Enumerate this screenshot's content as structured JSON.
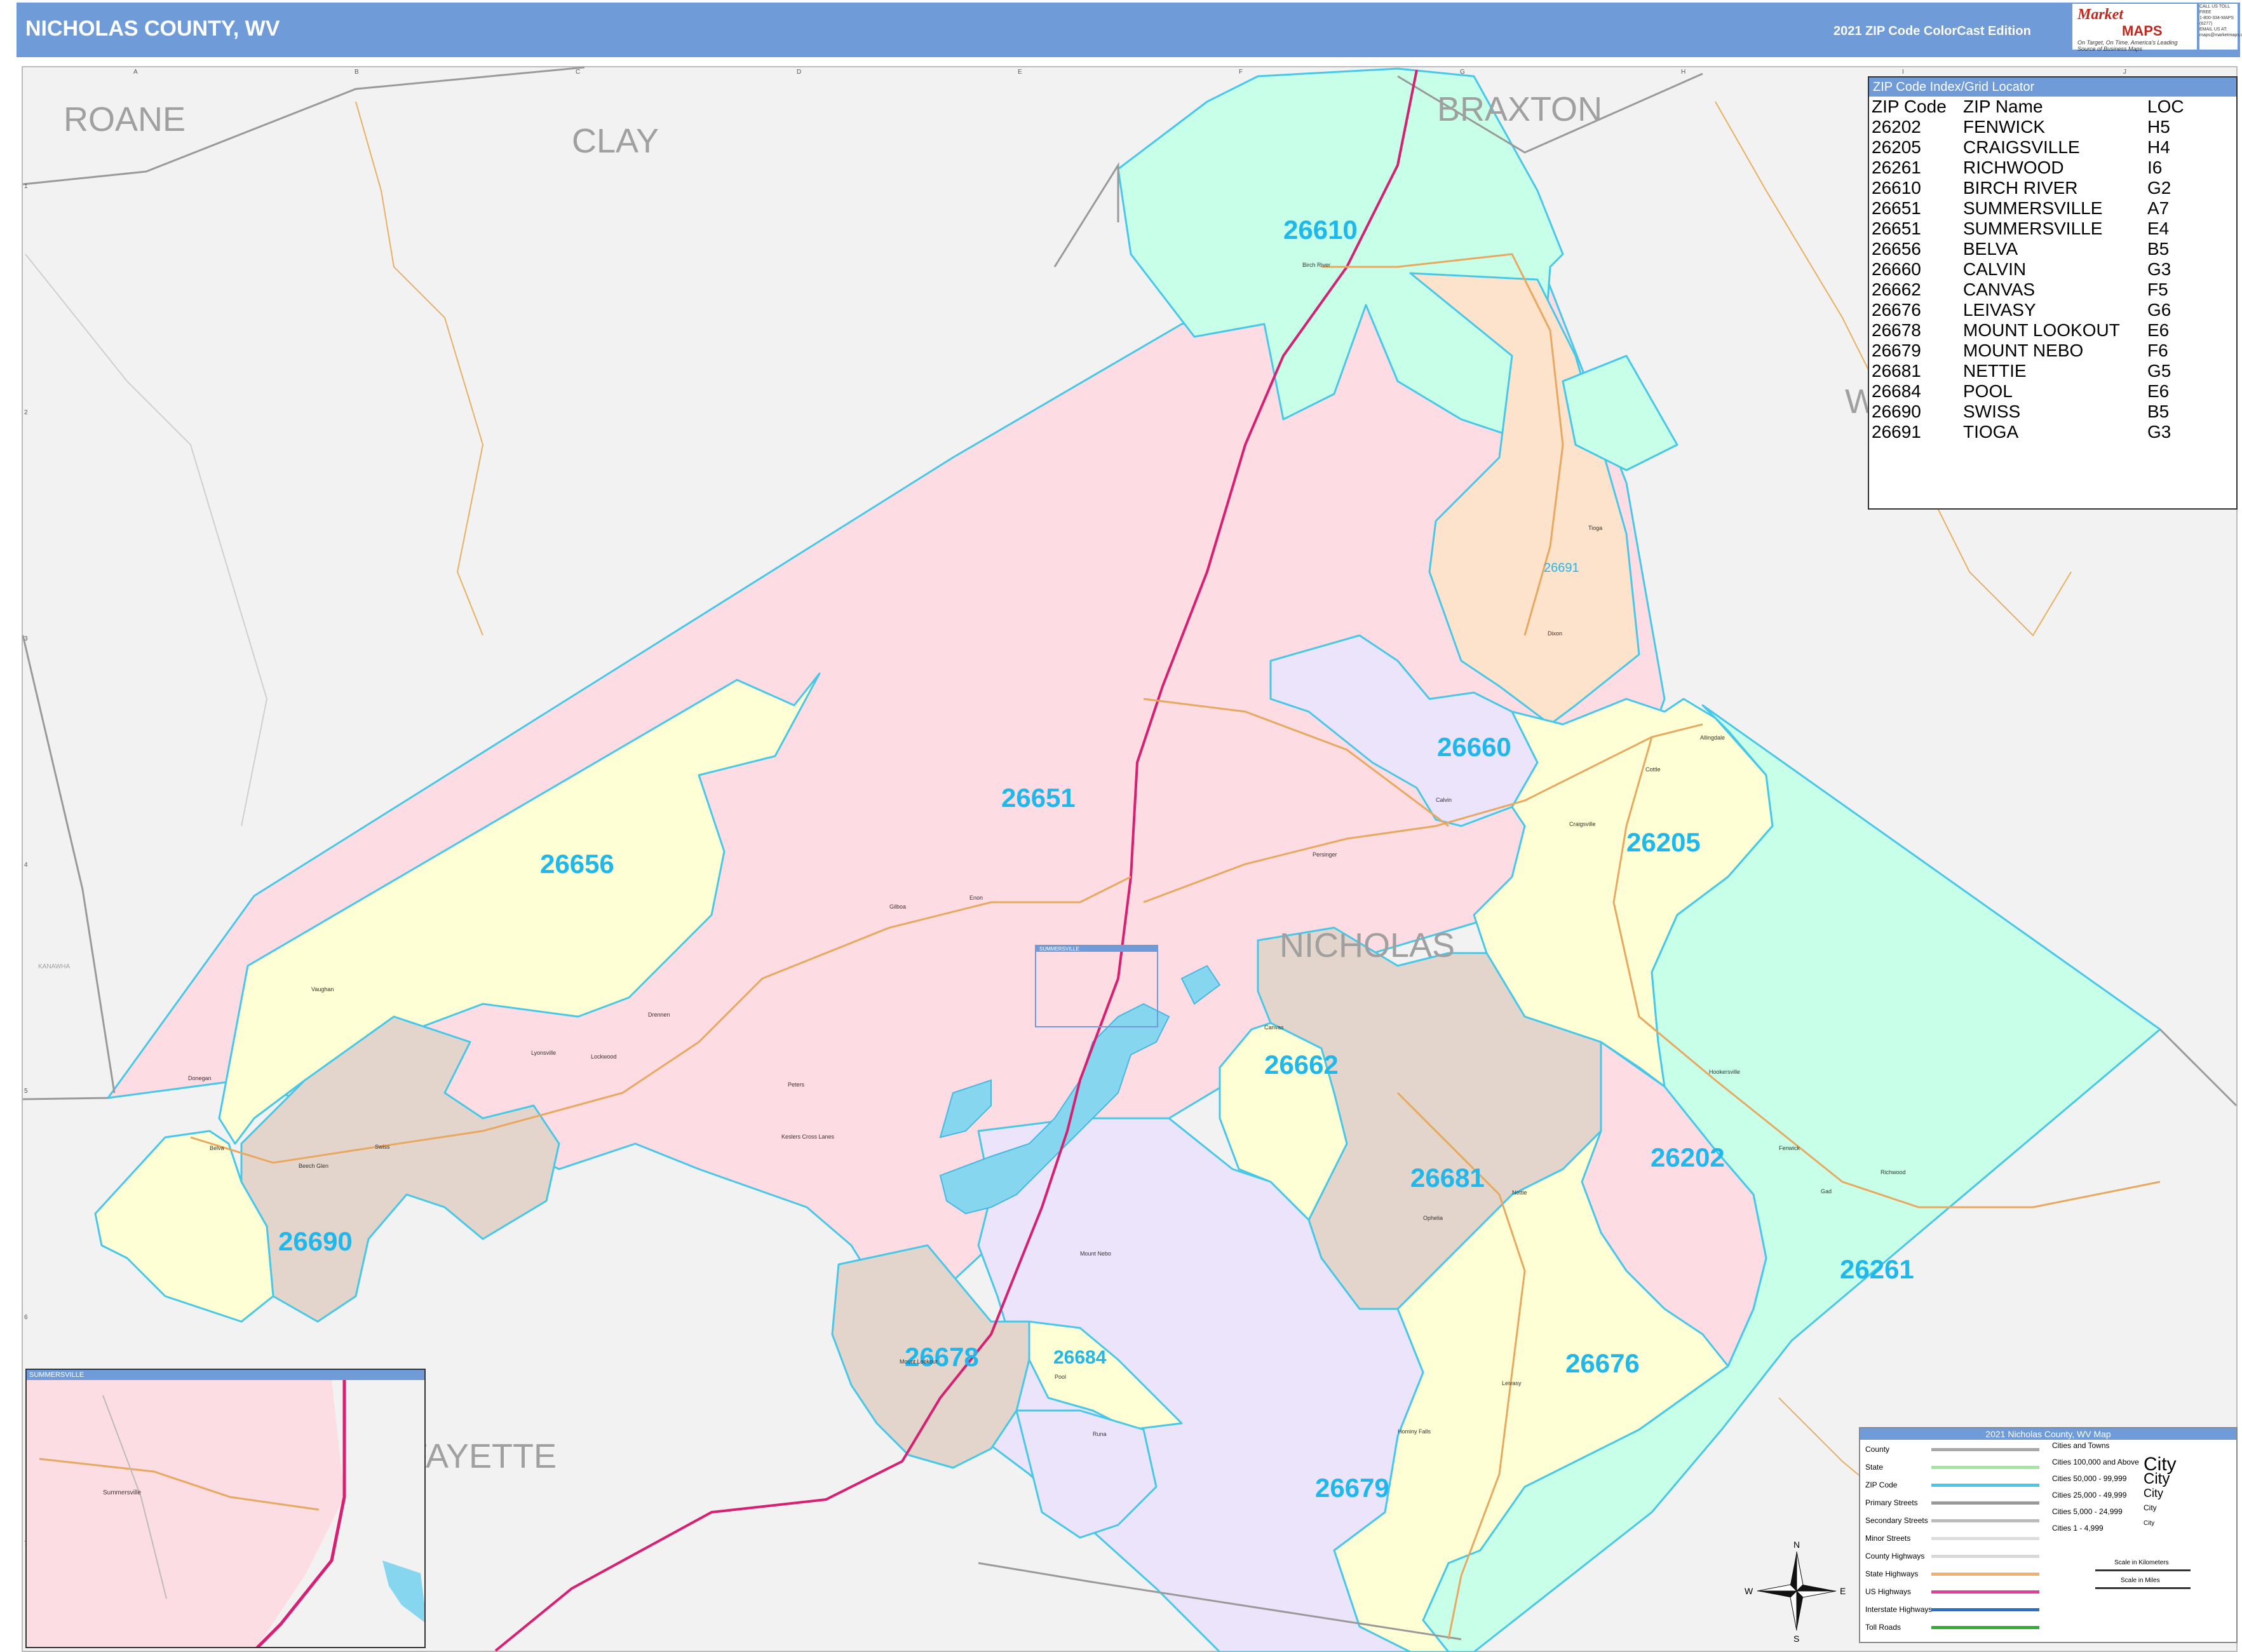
{
  "header": {
    "title": "NICHOLAS COUNTY, WV",
    "edition": "2021 ZIP Code ColorCast Edition"
  },
  "logo": {
    "brand_top": "Market",
    "brand_bottom": "MAPS",
    "tagline": "On Target, On Time. America's Leading Source of Business Maps"
  },
  "contact": {
    "line1": "CALL US TOLL FREE",
    "line2": "1-800-334-MAPS (6277)",
    "line3": "EMAIL US AT:",
    "line4": "maps@marketmaps.com"
  },
  "map": {
    "county_labels": {
      "roane": "ROANE",
      "clay": "CLAY",
      "braxton": "BRAXTON",
      "nicholas": "NICHOLAS",
      "fayette": "FAYETTE",
      "webster": "W",
      "kanawha": "KANAWHA"
    },
    "zip_labels": {
      "z26610": "26610",
      "z26651": "26651",
      "z26656": "26656",
      "z26660": "26660",
      "z26205": "26205",
      "z26691": "26691",
      "z26662": "26662",
      "z26681": "26681",
      "z26202": "26202",
      "z26690": "26690",
      "z26261": "26261",
      "z26678": "26678",
      "z26684": "26684",
      "z26676": "26676",
      "z26679": "26679"
    },
    "summersville_box_label": "SUMMERSVILLE",
    "grid_columns": [
      "A",
      "B",
      "C",
      "D",
      "E",
      "F",
      "G",
      "H",
      "I",
      "J"
    ],
    "grid_rows": [
      "1",
      "2",
      "3",
      "4",
      "5",
      "6",
      "7"
    ],
    "place_names": {
      "birch_river": "Birch River",
      "tioga": "Tioga",
      "dixon": "Dixon",
      "calvin": "Calvin",
      "craigsville": "Craigsville",
      "cottle": "Cottle",
      "allingdale": "Allingdale",
      "persinger": "Persinger",
      "gilboa": "Gilboa",
      "enon": "Enon",
      "vaughan": "Vaughan",
      "drennen": "Drennen",
      "lockwood": "Lockwood",
      "leivasy_town": "Leivasy",
      "belva": "Belva",
      "swiss": "Swiss",
      "beech_glen": "Beech Glen",
      "keslers_cross_lanes": "Keslers Cross Lanes",
      "peters": "Peters",
      "canvas": "Canvas",
      "nettie": "Nettie",
      "ophelia": "Ophelia",
      "hookersville": "Hookersville",
      "richwood": "Richwood",
      "fenwick": "Fenwick",
      "mount_nebo": "Mount Nebo",
      "mount_lookout": "Mount Lookout",
      "pool": "Pool",
      "runa": "Runa",
      "hominy_falls": "Hominy Falls",
      "lyonsville": "Lyonsville",
      "gad": "Gad",
      "donegan": "Donegan",
      "summersville_town": "Summersville"
    }
  },
  "zip_index": {
    "title": "ZIP Code Index/Grid Locator",
    "columns": [
      "ZIP Code",
      "ZIP Name",
      "LOC"
    ],
    "rows": [
      [
        "26202",
        "FENWICK",
        "H5"
      ],
      [
        "26205",
        "CRAIGSVILLE",
        "H4"
      ],
      [
        "26261",
        "RICHWOOD",
        "I6"
      ],
      [
        "26610",
        "BIRCH RIVER",
        "G2"
      ],
      [
        "26651",
        "SUMMERSVILLE",
        "A7"
      ],
      [
        "26651",
        "SUMMERSVILLE",
        "E4"
      ],
      [
        "26656",
        "BELVA",
        "B5"
      ],
      [
        "26660",
        "CALVIN",
        "G3"
      ],
      [
        "26662",
        "CANVAS",
        "F5"
      ],
      [
        "26676",
        "LEIVASY",
        "G6"
      ],
      [
        "26678",
        "MOUNT LOOKOUT",
        "E6"
      ],
      [
        "26679",
        "MOUNT NEBO",
        "F6"
      ],
      [
        "26681",
        "NETTIE",
        "G5"
      ],
      [
        "26684",
        "POOL",
        "E6"
      ],
      [
        "26690",
        "SWISS",
        "B5"
      ],
      [
        "26691",
        "TIOGA",
        "G3"
      ]
    ]
  },
  "legend": {
    "title": "2021 Nicholas County, WV Map",
    "rows": [
      "County",
      "State",
      "ZIP Code",
      "Primary Streets",
      "Secondary Streets",
      "Minor Streets",
      "County Highways",
      "State Highways",
      "US Highways",
      "Interstate Highways",
      "Toll Roads"
    ],
    "row_colors": [
      "#a8a8a8",
      "#9ee89e",
      "#48c8e8",
      "#999999",
      "#bbbbbb",
      "#dddddd",
      "#d8d8d8",
      "#f0b070",
      "#e0409a",
      "#2a70c8",
      "#30b030"
    ],
    "cities_header": "Cities and Towns",
    "city_classes": [
      "Cities 100,000 and Above",
      "Cities 50,000 - 99,999",
      "Cities 25,000 - 49,999",
      "Cities 5,000 - 24,999",
      "Cities 1 - 4,999"
    ],
    "city_word": "City",
    "scale_km": "Scale in Kilometers",
    "scale_mi": "Scale in Miles",
    "compass": {
      "n": "N",
      "s": "S",
      "e": "E",
      "w": "W"
    }
  },
  "inset": {
    "title": "SUMMERSVILLE",
    "place": "Summersville"
  },
  "colors": {
    "header": "#6f9bd8",
    "pink": "#fddde3",
    "yellow": "#ffffd6",
    "mint": "#c8ffe8",
    "lavender": "#ebe4fb",
    "tan": "#e3d5cb",
    "peach": "#fde2cc",
    "outside": "#f2f2f2",
    "zip_border": "#48c8e8",
    "zip_text": "#1fb8ec",
    "water": "#86d6f0",
    "road_us": "#d81f72",
    "road_state": "#e8a860"
  }
}
